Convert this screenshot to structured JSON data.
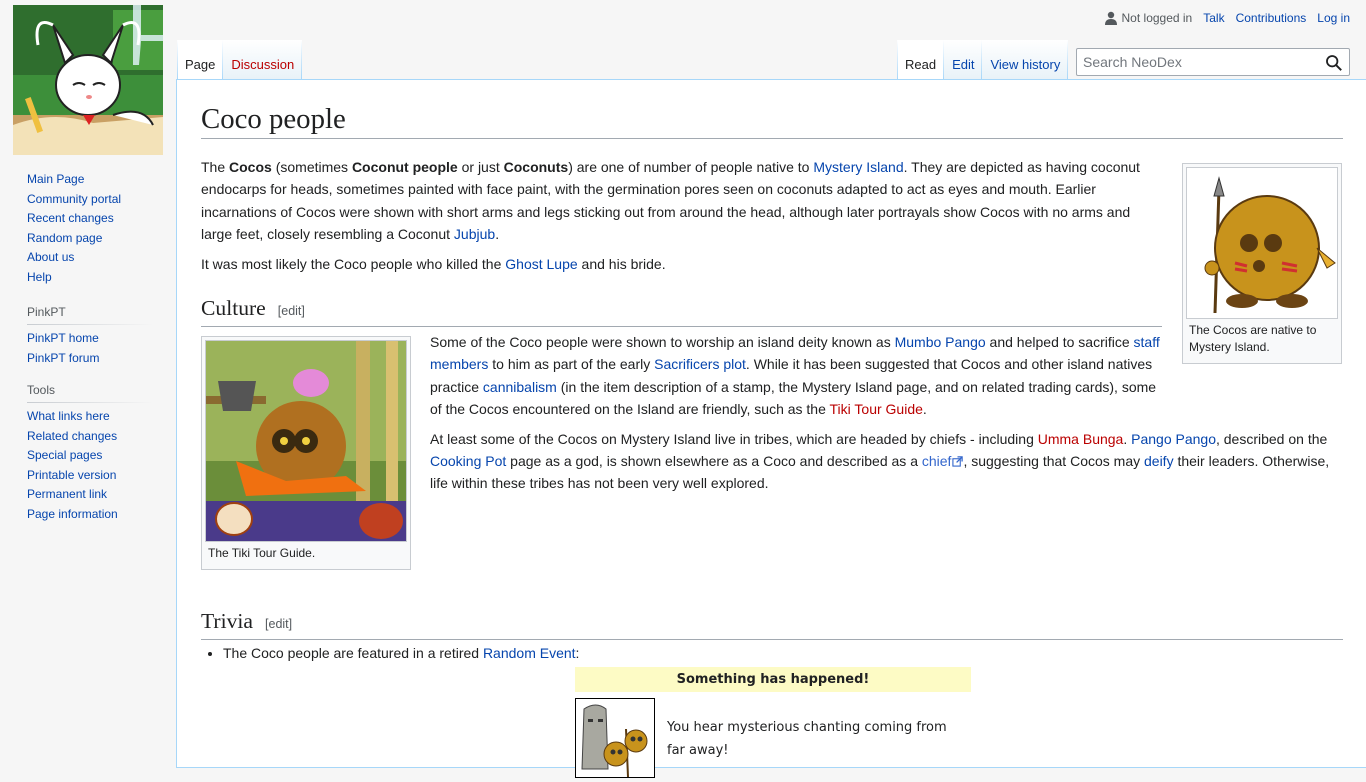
{
  "personal": {
    "not_logged_in": "Not logged in",
    "talk": "Talk",
    "contributions": "Contributions",
    "login": "Log in"
  },
  "tabs": {
    "page": "Page",
    "discussion": "Discussion",
    "read": "Read",
    "edit": "Edit",
    "history": "View history"
  },
  "search": {
    "placeholder": "Search NeoDex"
  },
  "nav": {
    "main": [
      "Main Page",
      "Community portal",
      "Recent changes",
      "Random page",
      "About us",
      "Help"
    ],
    "pinkpt_title": "PinkPT",
    "pinkpt": [
      "PinkPT home",
      "PinkPT forum"
    ],
    "tools_title": "Tools",
    "tools": [
      "What links here",
      "Related changes",
      "Special pages",
      "Printable version",
      "Permanent link",
      "Page information"
    ]
  },
  "article": {
    "title": "Coco people",
    "intro1": {
      "t1": "The ",
      "b1": "Cocos",
      "t2": " (sometimes ",
      "b2": "Coconut people",
      "t3": " or just ",
      "b3": "Coconuts",
      "t4": ") are one of number of people native to ",
      "l1": "Mystery Island",
      "t5": ". They are depicted as having coconut endocarps for heads, sometimes painted with face paint, with the germination pores seen on coconuts adapted to act as eyes and mouth. Earlier incarnations of Cocos were shown with short arms and legs sticking out from around the head, although later portrayals show Cocos with no arms and large feet, closely resembling a Coconut ",
      "l2": "Jubjub",
      "t6": "."
    },
    "intro2": {
      "t1": "It was most likely the Coco people who killed the ",
      "l1": "Ghost Lupe",
      "t2": " and his bride."
    },
    "infobox_caption": "The Cocos are native to Mystery Island.",
    "culture": {
      "heading": "Culture",
      "edit": "[edit]",
      "thumb_caption": "The Tiki Tour Guide.",
      "p1": {
        "t1": "Some of the Coco people were shown to worship an island deity known as ",
        "l1": "Mumbo Pango",
        "t2": " and helped to sacrifice ",
        "l2": "staff members",
        "t3": " to him as part of the early ",
        "l3": "Sacrificers plot",
        "t4": ". While it has been suggested that Cocos and other island natives practice ",
        "l4": "cannibalism",
        "t5": " (in the item description of a stamp, the Mystery Island page, and on related trading cards), some of the Cocos encountered on the Island are friendly, such as the ",
        "l5": "Tiki Tour Guide",
        "t6": "."
      },
      "p2": {
        "t1": "At least some of the Cocos on Mystery Island live in tribes, which are headed by chiefs - including ",
        "l1": "Umma Bunga",
        "t2": ". ",
        "l2": "Pango Pango",
        "t3": ", described on the ",
        "l3": "Cooking Pot",
        "t4": " page as a god, is shown elsewhere as a Coco and described as a ",
        "l4": "chief",
        "t5": ", suggesting that Cocos may ",
        "l5": "deify",
        "t6": " their leaders. Otherwise, life within these tribes has not been very well explored."
      }
    },
    "trivia": {
      "heading": "Trivia",
      "edit": "[edit]",
      "item1": {
        "t1": "The Coco people are featured in a retired ",
        "l1": "Random Event",
        "t2": ":"
      },
      "event_title": "Something has happened!",
      "event_text": "You hear mysterious chanting coming from far away!"
    }
  }
}
